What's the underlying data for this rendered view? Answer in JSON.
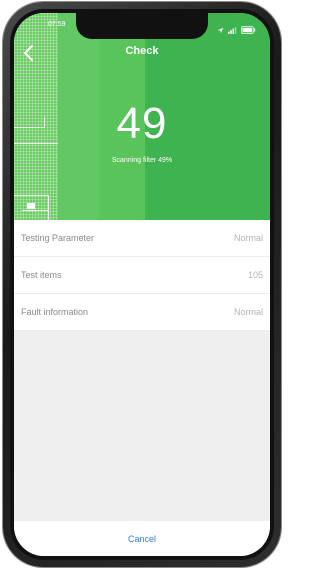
{
  "status_bar": {
    "time": "07:59"
  },
  "header": {
    "title": "Check"
  },
  "scan": {
    "value": "49",
    "text": "Scanning filter 49%",
    "progress_percent": 49
  },
  "list": {
    "rows": [
      {
        "label": "Testing Parameter",
        "value": "Normal"
      },
      {
        "label": "Test items",
        "value": "105"
      },
      {
        "label": "Fault information",
        "value": "Normal"
      }
    ]
  },
  "footer": {
    "cancel_label": "Cancel"
  },
  "colors": {
    "hero_green": "#3fb34f",
    "accent_blue": "#2f7de1"
  },
  "icons": {
    "back": "chevron-left-icon",
    "location": "location-arrow-icon",
    "signal": "signal-icon",
    "battery": "battery-icon"
  }
}
